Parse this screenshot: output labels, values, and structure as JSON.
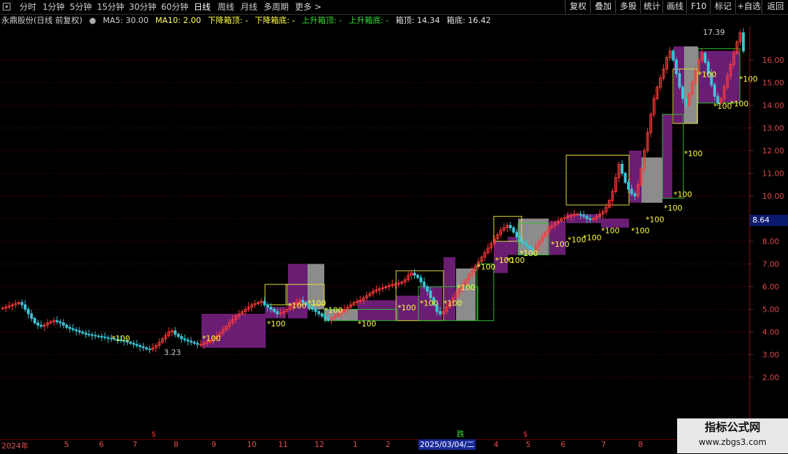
{
  "toolbar": {
    "periods": [
      "分时",
      "1分钟",
      "5分钟",
      "15分钟",
      "30分钟",
      "60分钟",
      "日线",
      "周线",
      "月线",
      "多周期",
      "更多 >"
    ],
    "active_period": "日线",
    "buttons": [
      "复权",
      "叠加",
      "多股",
      "统计",
      "画线",
      "F10",
      "标记",
      "+自选",
      "返回"
    ]
  },
  "legend": {
    "stock": "永鼎股份(日线 前复权)",
    "ma5": "MA5: 30.00",
    "ma10": "MA10: 2.00",
    "down_top": "下降箱顶: -",
    "down_bottom": "下降箱底: -",
    "up_top": "上升箱顶: -",
    "up_bottom": "上升箱底: -",
    "box_top": "箱顶: 14.34",
    "box_bottom": "箱底: 16.42",
    "colors": {
      "stock": "#d0d0d0",
      "ma5": "#d0d0d0",
      "ma10": "#ffff66",
      "down": "#ffff44",
      "up": "#33dd33",
      "box": "#e0e0e0"
    }
  },
  "price_tag": "8.64",
  "watermark": {
    "line1": "指标公式网",
    "line2": "www.zbgs3.com"
  },
  "bottom_axis": {
    "year_label": "2024年",
    "months": [
      "5",
      "6",
      "7",
      "8",
      "9",
      "10",
      "11",
      "12",
      "1",
      "2",
      "4",
      "5",
      "6",
      "7",
      "8",
      "9"
    ],
    "cursor_date": "2025/03/04/二",
    "s_marks": [
      "$",
      "$"
    ],
    "drop_mark": "跌"
  },
  "chart_data": {
    "type": "candlestick",
    "y_ticks": [
      "16.00",
      "15.00",
      "14.00",
      "13.00",
      "12.00",
      "11.00",
      "10.00",
      "9.00",
      "8.00",
      "7.00",
      "6.00",
      "5.00",
      "4.00",
      "3.00",
      "2.00"
    ],
    "y_values": [
      16,
      15,
      14,
      13,
      12,
      11,
      10,
      9,
      8,
      7,
      6,
      5,
      4,
      3,
      2
    ],
    "high_label": "17.39",
    "low_label": "3.23",
    "signal_label": "100",
    "signal_prices": [
      3.85,
      3.85,
      4.5,
      5.3,
      5.4,
      5.1,
      4.5,
      5.2,
      5.4,
      5.4,
      6.1,
      7.0,
      7.3,
      7.3,
      7.6,
      8.0,
      8.2,
      8.3,
      8.6,
      8.6,
      9.1,
      9.6,
      10.2,
      12.0,
      15.5,
      14.1,
      14.2,
      15.3
    ],
    "closes": [
      5.05,
      5.1,
      5.15,
      5.2,
      5.25,
      5.3,
      5.2,
      5.0,
      4.8,
      4.6,
      4.4,
      4.3,
      4.25,
      4.3,
      4.4,
      4.45,
      4.5,
      4.45,
      4.4,
      4.3,
      4.2,
      4.15,
      4.1,
      4.05,
      4.0,
      3.95,
      3.9,
      3.88,
      3.85,
      3.82,
      3.8,
      3.78,
      3.75,
      3.72,
      3.7,
      3.68,
      3.65,
      3.62,
      3.6,
      3.55,
      3.5,
      3.45,
      3.4,
      3.35,
      3.3,
      3.25,
      3.23,
      3.3,
      3.4,
      3.55,
      3.7,
      3.85,
      4.0,
      4.05,
      3.9,
      3.8,
      3.7,
      3.65,
      3.6,
      3.55,
      3.5,
      3.45,
      3.45,
      3.5,
      3.55,
      3.6,
      3.7,
      3.8,
      3.95,
      4.1,
      4.25,
      4.4,
      4.55,
      4.7,
      4.8,
      4.9,
      5.0,
      5.1,
      5.2,
      5.25,
      5.3,
      5.35,
      5.2,
      5.1,
      5.0,
      4.9,
      4.8,
      4.85,
      4.9,
      5.0,
      5.1,
      5.2,
      5.3,
      5.4,
      5.3,
      5.2,
      5.1,
      5.0,
      4.9,
      4.8,
      4.7,
      4.6,
      4.55,
      4.6,
      4.7,
      4.8,
      4.9,
      5.0,
      5.1,
      5.2,
      5.3,
      5.35,
      5.4,
      5.5,
      5.6,
      5.7,
      5.8,
      5.85,
      5.9,
      5.95,
      6.0,
      6.05,
      6.1,
      6.1,
      6.15,
      6.2,
      6.3,
      6.5,
      6.6,
      6.5,
      6.4,
      6.2,
      6.0,
      5.8,
      5.5,
      5.2,
      4.9,
      4.8,
      4.9,
      5.1,
      5.3,
      5.5,
      5.7,
      5.9,
      6.1,
      6.3,
      6.5,
      6.7,
      6.9,
      7.1,
      7.3,
      7.5,
      7.7,
      7.9,
      8.1,
      8.3,
      8.5,
      8.6,
      8.7,
      8.6,
      8.4,
      8.2,
      8.0,
      7.9,
      7.8,
      7.7,
      7.6,
      7.8,
      8.0,
      8.2,
      8.4,
      8.6,
      8.7,
      8.8,
      8.9,
      9.0,
      9.05,
      9.1,
      9.15,
      9.2,
      9.2,
      9.15,
      9.1,
      9.0,
      8.95,
      9.0,
      9.1,
      9.2,
      9.3,
      9.5,
      9.8,
      10.2,
      10.8,
      11.4,
      11.0,
      10.6,
      10.3,
      10.1,
      10.0,
      10.5,
      11.2,
      12.0,
      12.8,
      13.6,
      14.3,
      14.8,
      15.2,
      15.6,
      16.1,
      16.4,
      16.0,
      15.4,
      14.8,
      14.3,
      14.0,
      14.5,
      15.0,
      15.5,
      16.0,
      16.3,
      15.9,
      15.4,
      14.9,
      14.4,
      14.1,
      14.3,
      14.8,
      15.3,
      15.8,
      16.3,
      16.8,
      17.2,
      16.4
    ]
  }
}
